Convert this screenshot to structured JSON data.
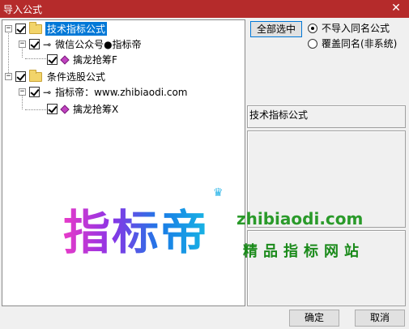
{
  "window": {
    "title": "导入公式",
    "close_glyph": "✕"
  },
  "tree": {
    "nodes": [
      {
        "label": "技术指标公式",
        "selected": true
      },
      {
        "label": "微信公众号●指标帝"
      },
      {
        "label": "擒龙抢筹F"
      },
      {
        "label": "条件选股公式"
      },
      {
        "label": "指标帝：www.zhibiaodi.com"
      },
      {
        "label": "擒龙抢筹X"
      }
    ],
    "expander_glyph": "−"
  },
  "side": {
    "select_all_label": "全部选中",
    "radio_options": [
      {
        "label": "不导入同名公式",
        "checked": true
      },
      {
        "label": "覆盖同名(非系统)",
        "checked": false
      }
    ],
    "formula_type_label": "技术指标公式"
  },
  "watermark": {
    "brand": "指标帝",
    "url": "zhibiaodi.com",
    "tagline": "精品指标网站"
  },
  "footer": {
    "ok_label": "确定",
    "cancel_label": "取消"
  },
  "colors": {
    "titlebar": "#b52b2b",
    "selection": "#0078d7"
  }
}
